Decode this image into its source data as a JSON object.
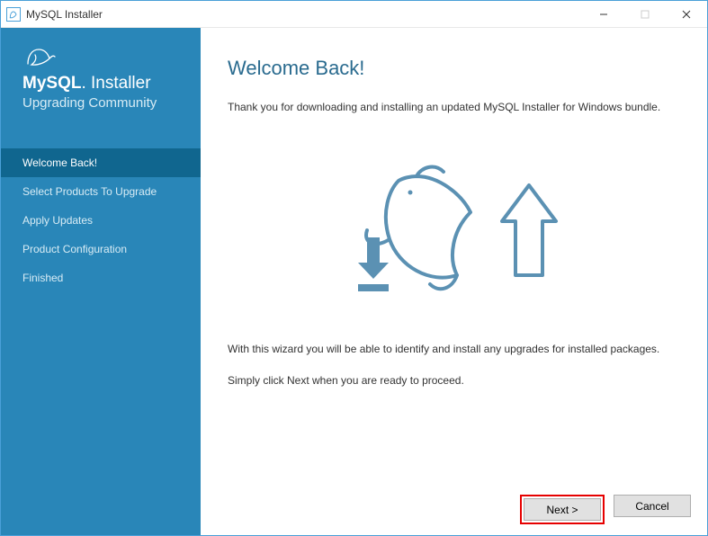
{
  "window": {
    "title": "MySQL Installer"
  },
  "sidebar": {
    "brand_prefix": "MySQL",
    "brand_suffix": ". Installer",
    "subtitle": "Upgrading Community",
    "items": [
      {
        "label": "Welcome Back!",
        "active": true
      },
      {
        "label": "Select Products To Upgrade",
        "active": false
      },
      {
        "label": "Apply Updates",
        "active": false
      },
      {
        "label": "Product Configuration",
        "active": false
      },
      {
        "label": "Finished",
        "active": false
      }
    ]
  },
  "main": {
    "heading": "Welcome Back!",
    "intro": "Thank you for downloading and installing an updated MySQL Installer for Windows bundle.",
    "info": "With this wizard you will be able to identify and install any upgrades for installed packages.",
    "proceed": "Simply click Next when you are ready to proceed."
  },
  "footer": {
    "next_label": "Next >",
    "cancel_label": "Cancel"
  },
  "colors": {
    "sidebar_bg": "#2986b8",
    "sidebar_active": "#10668f",
    "heading": "#2a6b8f"
  }
}
